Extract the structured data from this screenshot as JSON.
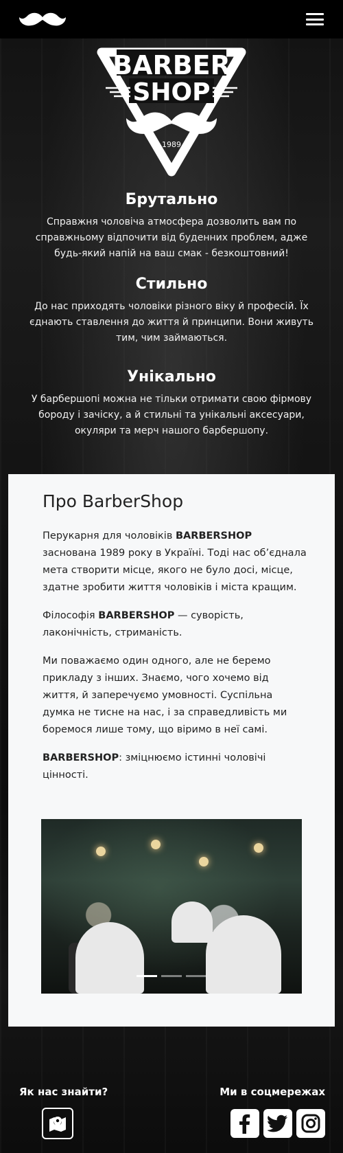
{
  "navbar": {
    "logo_icon": "mustache-icon",
    "menu_icon": "hamburger-icon"
  },
  "hero": {
    "logo_line1": "BARBER",
    "logo_line2": "SHOP",
    "logo_year": "1989"
  },
  "features": [
    {
      "title": "Брутально",
      "text": "Справжня чоловіча атмосфера дозволить вам по справжньому відпочити від буденних проблем, адже будь-який напій на ваш смак - безкоштовний!"
    },
    {
      "title": "Стильно",
      "text": "До нас приходять чоловіки різного віку й професій. Їх єднають ставлення до життя й принципи. Вони живуть тим, чим займаються."
    },
    {
      "title": "Унікально",
      "text": "У барбершопі можна не тільки отримати свою фірмову бороду і зачіску, а й стильні та унікальні аксесуари, окуляри та мерч нашого барбершопу."
    }
  ],
  "about": {
    "title": "Про BarberShop",
    "p1_before": "Перукарня для чоловіків ",
    "p1_bold": "BARBERSHOP",
    "p1_after": " заснована 1989 року в Україні. Тоді нас об’єднала мета створити місце, якого не було досі, місце, здатне зробити життя чоловіків і міста кращим.",
    "p2_before": "Філософія ",
    "p2_bold": "BARBERSHOP",
    "p2_after": " — суворість, лаконічність, стриманість.",
    "p3": "Ми поважаємо один одного, але не беремо прикладу з інших. Знаємо, чого хочемо від життя, й заперечуємо умовності. Суспільна думка не тисне на нас, і за справедливість ми боремося лише тому, що віримо в неї самі.",
    "p4_bold": "BARBERSHOP",
    "p4_after": ": зміцнюємо істинні чоловічі цінності."
  },
  "carousel": {
    "slides": 3,
    "active_index": 0
  },
  "footer": {
    "find_us": "Як нас знайти?",
    "social": "Ми в соцмережах",
    "map_icon": "map-marker-icon",
    "social_icons": [
      "facebook-icon",
      "twitter-icon",
      "instagram-icon"
    ]
  }
}
